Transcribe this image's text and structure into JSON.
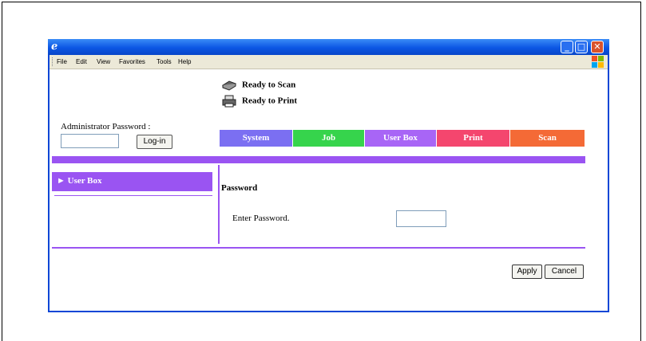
{
  "menubar": {
    "items": [
      "File",
      "Edit",
      "View",
      "Favorites",
      "Tools",
      "Help"
    ]
  },
  "status": {
    "scan": "Ready to Scan",
    "print": "Ready to Print"
  },
  "admin": {
    "label": "Administrator Password :",
    "login_button": "Log-in"
  },
  "tabs": [
    {
      "label": "System",
      "color": "#7b6ff2"
    },
    {
      "label": "Job",
      "color": "#36d44c"
    },
    {
      "label": "User Box",
      "color": "#a865f6"
    },
    {
      "label": "Print",
      "color": "#f4466e"
    },
    {
      "label": "Scan",
      "color": "#f46a36"
    }
  ],
  "sidebar": {
    "selected_item": "User Box"
  },
  "main": {
    "section_title": "Password",
    "field_label": "Enter Password."
  },
  "actions": {
    "apply": "Apply",
    "cancel": "Cancel"
  },
  "colors": {
    "accent": "#9a54f2",
    "titlebar": "#0b56e4"
  }
}
